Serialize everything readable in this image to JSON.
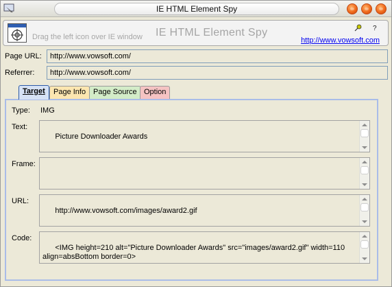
{
  "window": {
    "title": "IE HTML Element Spy"
  },
  "header": {
    "drag_hint": "Drag the left icon over IE window",
    "title": "IE HTML Element Spy",
    "help_label": "?",
    "link": "http://www.vowsoft.com"
  },
  "page": {
    "url_label": "Page URL:",
    "url_value": "http://www.vowsoft.com/",
    "referrer_label": "Referrer:",
    "referrer_value": "http://www.vowsoft.com/"
  },
  "tabs": [
    {
      "label": "Target",
      "active": true
    },
    {
      "label": "Page Info"
    },
    {
      "label": "Page Source"
    },
    {
      "label": "Option"
    }
  ],
  "target": {
    "type_label": "Type:",
    "type_value": "IMG",
    "text_label": "Text:",
    "text_value": "Picture Downloader Awards",
    "frame_label": "Frame:",
    "frame_value": "",
    "url_label": "URL:",
    "url_value": "http://www.vowsoft.com/images/award2.gif",
    "code_label": "Code:",
    "code_value": "<IMG height=210 alt=\"Picture Downloader Awards\" src=\"images/award2.gif\" width=110\nalign=absBottom border=0>"
  },
  "colors": {
    "accent": "#2b5aa8",
    "close_buttons": "#f06a1c",
    "link": "#0000ee"
  },
  "icons": [
    "app-icon",
    "crosshair-target-icon",
    "pin-icon",
    "minimize-icon",
    "maximize-icon",
    "close-icon"
  ]
}
